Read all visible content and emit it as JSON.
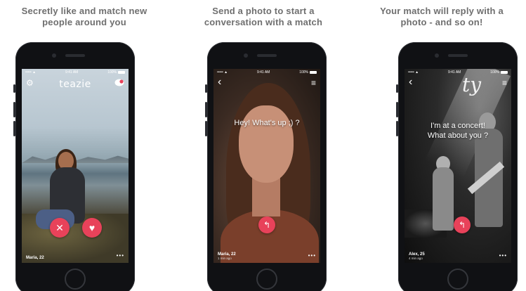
{
  "panels": [
    {
      "caption_line1": "Secretly like and match new",
      "caption_line2": "people around you",
      "status_time": "9:41 AM",
      "status_carrier": "••••• ▲",
      "status_battery": "100%",
      "logo": "teazie",
      "person_name": "Maria, 22",
      "more": "•••"
    },
    {
      "caption_line1": "Send a photo to start a",
      "caption_line2": "conversation with a match",
      "status_time": "9:41 AM",
      "status_carrier": "••••• ▲",
      "status_battery": "100%",
      "message": "Hey! What's up ;) ?",
      "person_name": "Maria, 22",
      "person_ago": "1 min ago",
      "more": "•••"
    },
    {
      "caption_line1": "Your match will reply with a",
      "caption_line2": "photo - and so on!",
      "status_time": "9:41 AM",
      "status_carrier": "••••• ▲",
      "status_battery": "100%",
      "message_line1": "I'm at a concert!",
      "message_line2": "What about you ?",
      "person_name": "Alex, 25",
      "person_ago": "4 min ago",
      "more": "•••"
    }
  ],
  "icons": {
    "settings": "⚙",
    "chat": "●",
    "back": "‹",
    "menu": "≡",
    "dislike": "✕",
    "like": "♥",
    "reply": "↰"
  },
  "colors": {
    "accent": "#e8425a",
    "caption": "#6f6f6f"
  }
}
